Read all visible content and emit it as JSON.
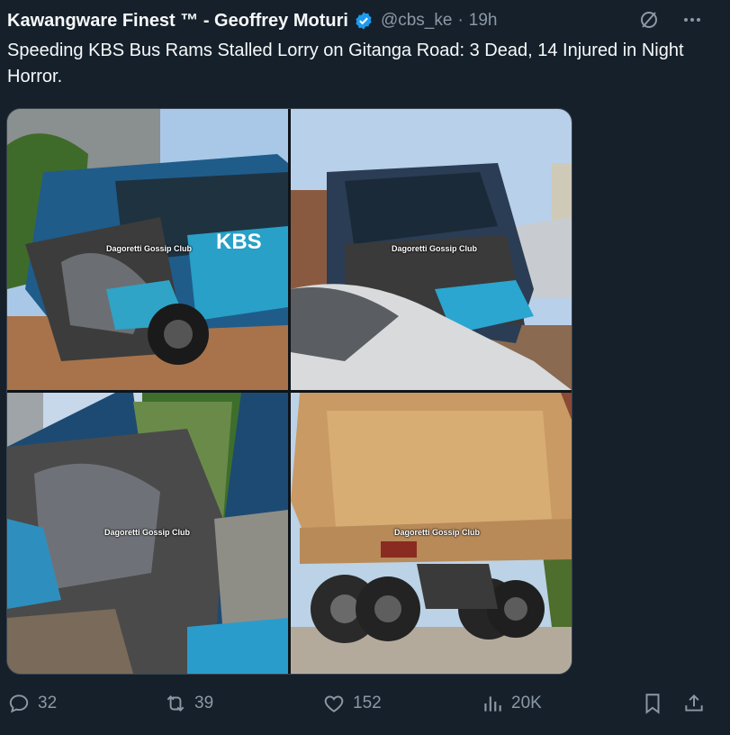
{
  "author": {
    "display_name": "Kawangware Finest ™ - Geoffrey Moturi",
    "handle": "@cbs_ke",
    "separator": "·",
    "time": "19h"
  },
  "tweet": {
    "text": "Speeding KBS Bus Rams Stalled Lorry on Gitanga Road: 3 Dead, 14 Injured in Night Horror."
  },
  "photos": [
    {
      "watermark": "Dagoretti Gossip Club",
      "subject": "wrecked blue KBS bus front view"
    },
    {
      "watermark": "Dagoretti Gossip Club",
      "subject": "crushed bus front, white car"
    },
    {
      "watermark": "Dagoretti Gossip Club",
      "subject": "bus cabin interior debris"
    },
    {
      "watermark": "Dagoretti Gossip Club",
      "subject": "rear of orange dump truck"
    }
  ],
  "bus_logo_text": "KBS",
  "actions": {
    "replies": "32",
    "retweets": "39",
    "likes": "152",
    "views": "20K"
  },
  "colors": {
    "background": "#15202b",
    "text": "#f7f9f9",
    "muted": "#8b98a5",
    "verified": "#1d9bf0"
  }
}
